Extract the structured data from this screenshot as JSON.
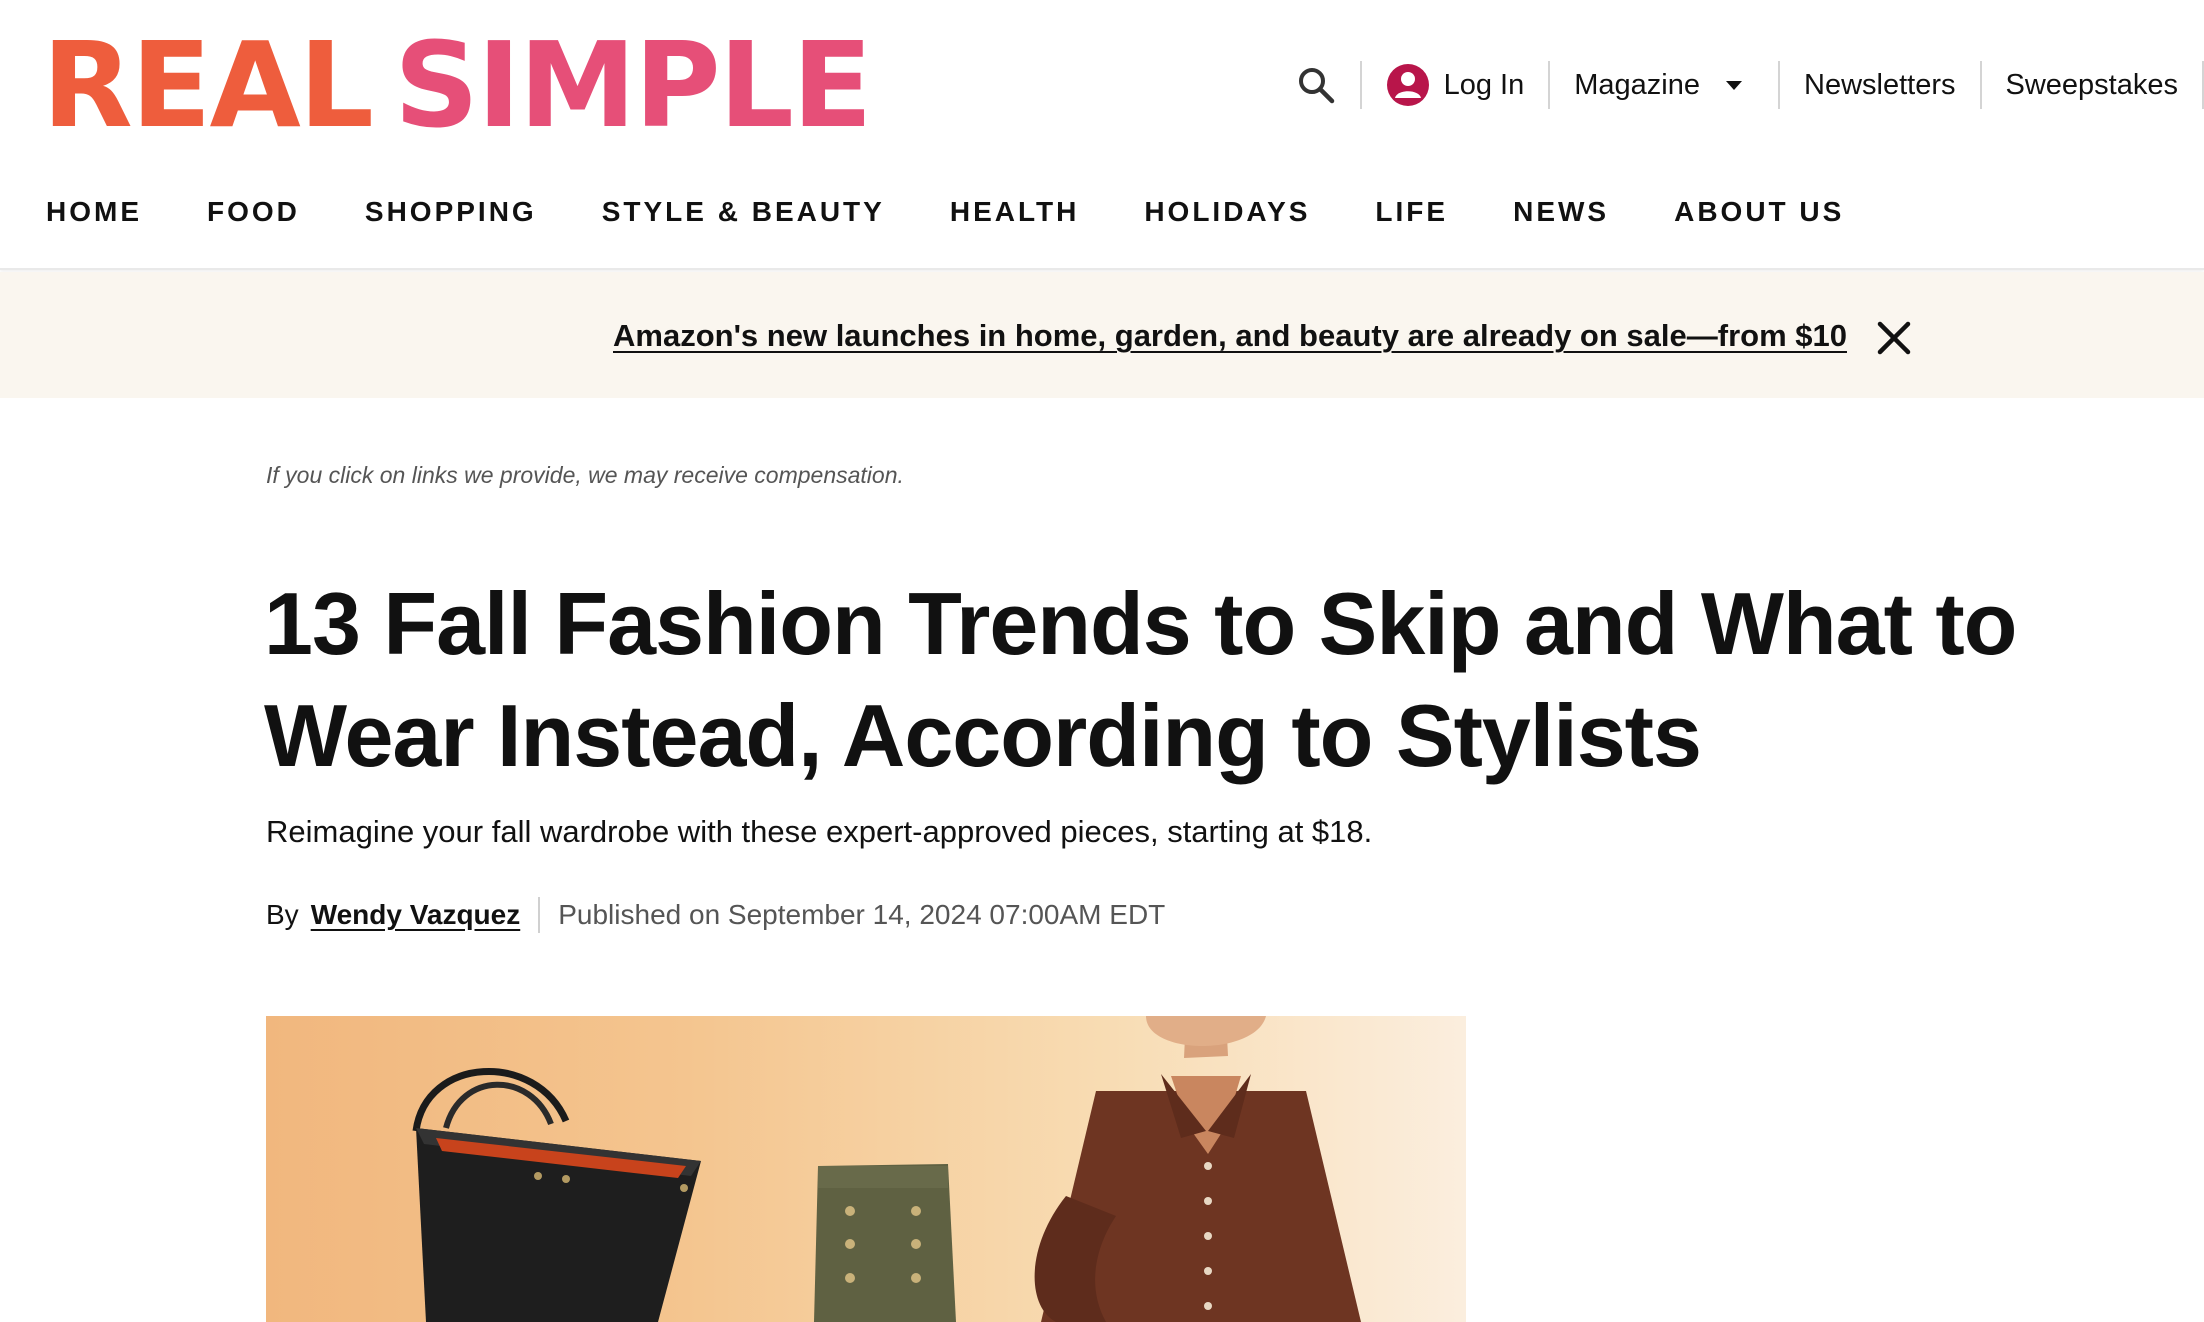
{
  "site": {
    "logo_word1": "REAL",
    "logo_word2": "SIMPLE",
    "brand_colors": {
      "orange": "#ee5d3d",
      "pink": "#e64f78"
    }
  },
  "utility_nav": {
    "search_icon": "search-icon",
    "login_label": "Log In",
    "magazine_label": "Magazine",
    "newsletters_label": "Newsletters",
    "sweepstakes_label": "Sweepstakes"
  },
  "main_nav": {
    "items": [
      "HOME",
      "FOOD",
      "SHOPPING",
      "STYLE & BEAUTY",
      "HEALTH",
      "HOLIDAYS",
      "LIFE",
      "NEWS",
      "ABOUT US"
    ]
  },
  "promo_banner": {
    "text": "Amazon's new launches in home, garden, and beauty are already on sale—from $10",
    "close_icon": "close-icon"
  },
  "article": {
    "disclaimer": "If you click on links we provide, we may receive compensation.",
    "title": "13 Fall Fashion Trends to Skip and What to Wear Instead, According to Stylists",
    "dek": "Reimagine your fall wardrobe with these expert-approved pieces, starting at $18.",
    "by_label": "By",
    "author": "Wendy Vazquez",
    "published": "Published on September 14, 2024 07:00AM EDT"
  }
}
